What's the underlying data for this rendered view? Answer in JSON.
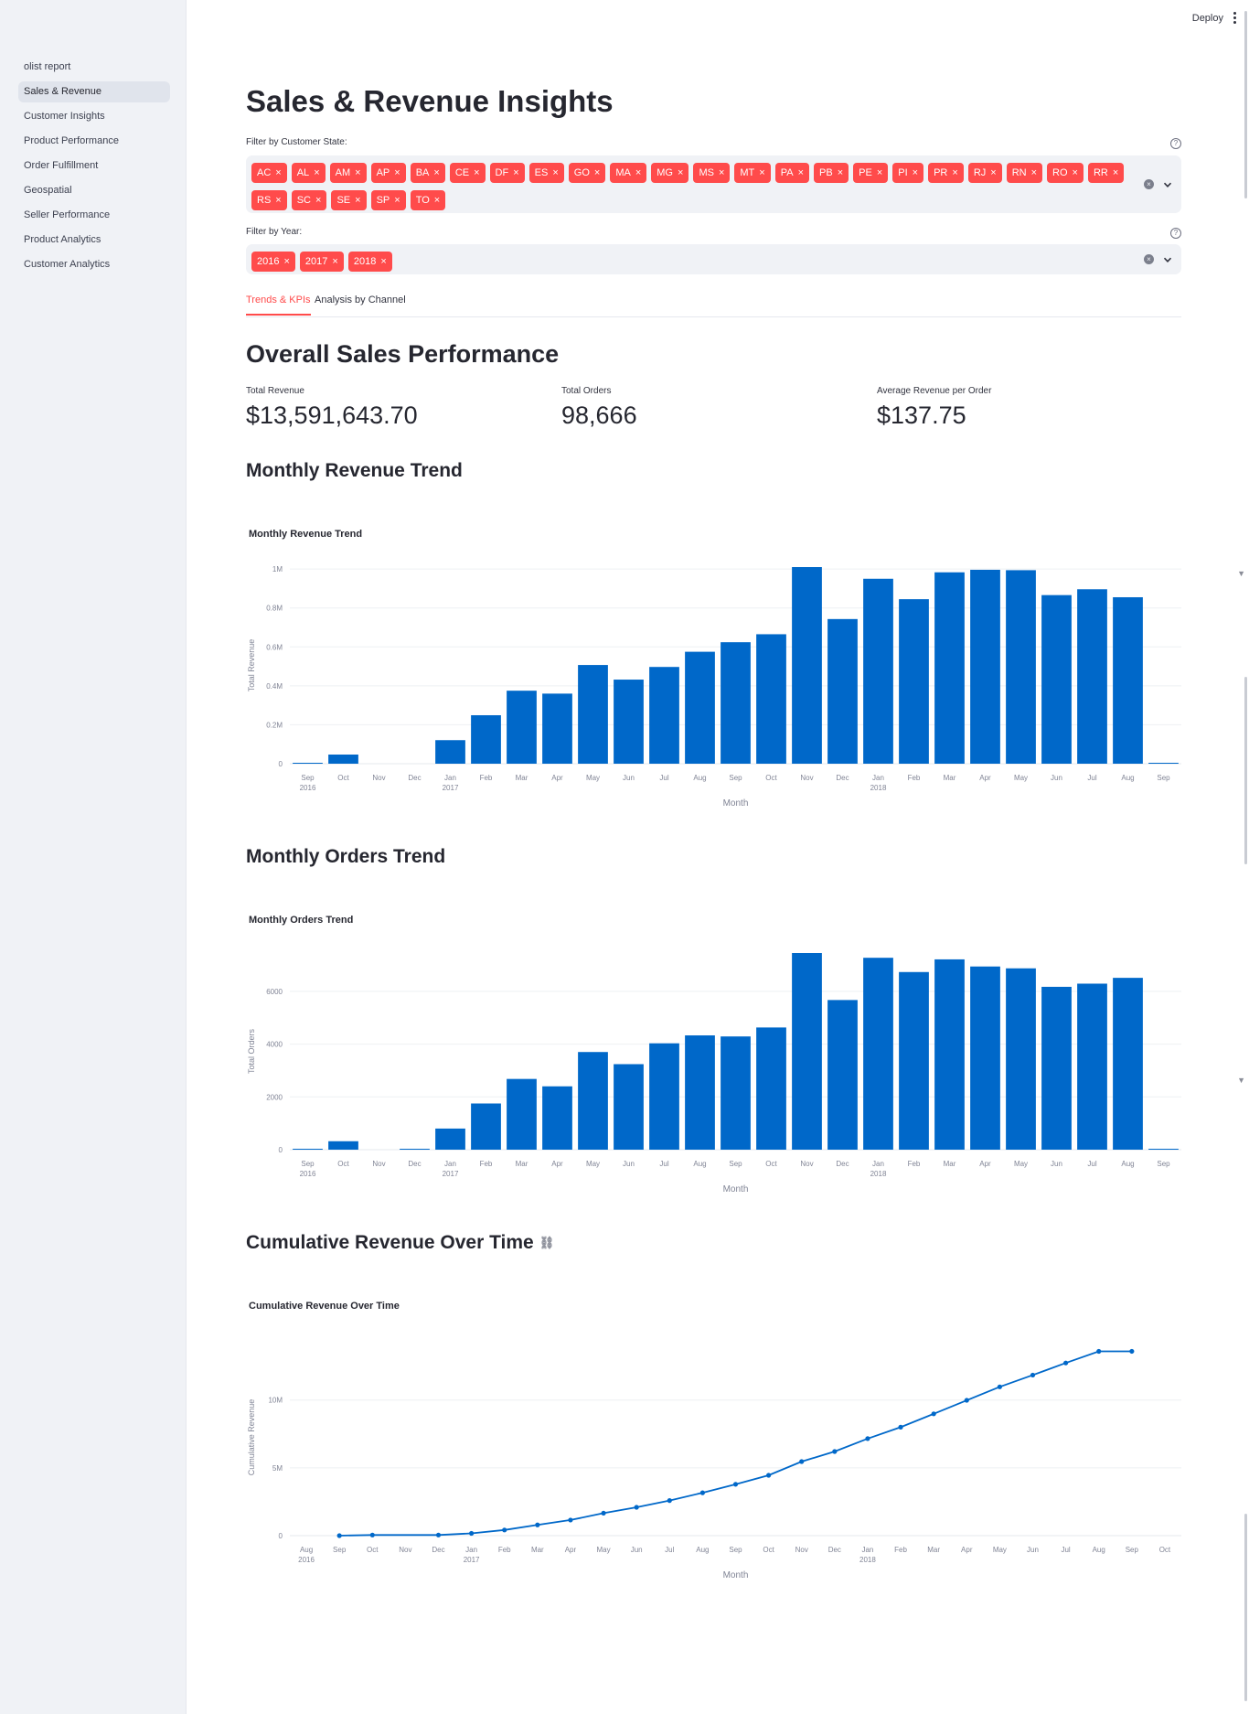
{
  "sidebar": {
    "items": [
      {
        "label": "olist report",
        "active": false
      },
      {
        "label": "Sales & Revenue",
        "active": true
      },
      {
        "label": "Customer Insights",
        "active": false
      },
      {
        "label": "Product Performance",
        "active": false
      },
      {
        "label": "Order Fulfillment",
        "active": false
      },
      {
        "label": "Geospatial",
        "active": false
      },
      {
        "label": "Seller Performance",
        "active": false
      },
      {
        "label": "Product Analytics",
        "active": false
      },
      {
        "label": "Customer Analytics",
        "active": false
      }
    ]
  },
  "header": {
    "deploy_label": "Deploy"
  },
  "page": {
    "title": "Sales & Revenue Insights"
  },
  "filters": {
    "state": {
      "label": "Filter by Customer State:",
      "selected": [
        "AC",
        "AL",
        "AM",
        "AP",
        "BA",
        "CE",
        "DF",
        "ES",
        "GO",
        "MA",
        "MG",
        "MS",
        "MT",
        "PA",
        "PB",
        "PE",
        "PI",
        "PR",
        "RJ",
        "RN",
        "RO",
        "RR",
        "RS",
        "SC",
        "SE",
        "SP",
        "TO"
      ]
    },
    "year": {
      "label": "Filter by Year:",
      "selected": [
        "2016",
        "2017",
        "2018"
      ]
    },
    "chip_remove_glyph": "×",
    "help_glyph": "?",
    "clear_glyph": "×"
  },
  "tabs": [
    {
      "label": "Trends & KPIs",
      "active": true
    },
    {
      "label": "Analysis by Channel",
      "active": false
    }
  ],
  "overview": {
    "heading": "Overall Sales Performance",
    "metrics": [
      {
        "label": "Total Revenue",
        "value": "$13,591,643.70"
      },
      {
        "label": "Total Orders",
        "value": "98,666"
      },
      {
        "label": "Average Revenue per Order",
        "value": "$137.75"
      }
    ]
  },
  "sections": {
    "revenue_heading": "Monthly Revenue Trend",
    "orders_heading": "Monthly Orders Trend",
    "cumulative_heading": "Cumulative Revenue Over Time"
  },
  "colors": {
    "accent": "#ff4b4b",
    "bar": "#0068c9",
    "sidebar_bg": "#f0f2f6"
  },
  "icons": [
    "help-icon",
    "clear-icon",
    "chevron-down-icon",
    "link-icon",
    "kebab-menu-icon"
  ],
  "chart_data": [
    {
      "type": "bar",
      "title": "Monthly Revenue Trend",
      "xlabel": "Month",
      "ylabel": "Total Revenue",
      "x_ticks": [
        [
          "Sep",
          "2016"
        ],
        [
          "Oct",
          ""
        ],
        [
          "Nov",
          ""
        ],
        [
          "Dec",
          ""
        ],
        [
          "Jan",
          "2017"
        ],
        [
          "Feb",
          ""
        ],
        [
          "Mar",
          ""
        ],
        [
          "Apr",
          ""
        ],
        [
          "May",
          ""
        ],
        [
          "Jun",
          ""
        ],
        [
          "Jul",
          ""
        ],
        [
          "Aug",
          ""
        ],
        [
          "Sep",
          ""
        ],
        [
          "Oct",
          ""
        ],
        [
          "Nov",
          ""
        ],
        [
          "Dec",
          ""
        ],
        [
          "Jan",
          "2018"
        ],
        [
          "Feb",
          ""
        ],
        [
          "Mar",
          ""
        ],
        [
          "Apr",
          ""
        ],
        [
          "May",
          ""
        ],
        [
          "Jun",
          ""
        ],
        [
          "Jul",
          ""
        ],
        [
          "Aug",
          ""
        ],
        [
          "Sep",
          ""
        ]
      ],
      "values": [
        300,
        47000,
        0,
        0,
        121000,
        249000,
        375000,
        360000,
        507000,
        432000,
        497000,
        575000,
        624000,
        665000,
        1010000,
        743000,
        950000,
        845000,
        983000,
        996000,
        994000,
        866000,
        896000,
        855000,
        150
      ],
      "y_ticks": [
        {
          "v": 0,
          "label": "0"
        },
        {
          "v": 200000,
          "label": "0.2M"
        },
        {
          "v": 400000,
          "label": "0.4M"
        },
        {
          "v": 600000,
          "label": "0.6M"
        },
        {
          "v": 800000,
          "label": "0.8M"
        },
        {
          "v": 1000000,
          "label": "1M"
        }
      ],
      "ylim": [
        0,
        1010000
      ],
      "grid": true
    },
    {
      "type": "bar",
      "title": "Monthly Orders Trend",
      "xlabel": "Month",
      "ylabel": "Total Orders",
      "x_ticks": [
        [
          "Sep",
          "2016"
        ],
        [
          "Oct",
          ""
        ],
        [
          "Nov",
          ""
        ],
        [
          "Dec",
          ""
        ],
        [
          "Jan",
          "2017"
        ],
        [
          "Feb",
          ""
        ],
        [
          "Mar",
          ""
        ],
        [
          "Apr",
          ""
        ],
        [
          "May",
          ""
        ],
        [
          "Jun",
          ""
        ],
        [
          "Jul",
          ""
        ],
        [
          "Aug",
          ""
        ],
        [
          "Sep",
          ""
        ],
        [
          "Oct",
          ""
        ],
        [
          "Nov",
          ""
        ],
        [
          "Dec",
          ""
        ],
        [
          "Jan",
          "2018"
        ],
        [
          "Feb",
          ""
        ],
        [
          "Mar",
          ""
        ],
        [
          "Apr",
          ""
        ],
        [
          "May",
          ""
        ],
        [
          "Jun",
          ""
        ],
        [
          "Jul",
          ""
        ],
        [
          "Aug",
          ""
        ],
        [
          "Sep",
          ""
        ]
      ],
      "values": [
        4,
        320,
        0,
        1,
        800,
        1750,
        2680,
        2400,
        3700,
        3240,
        4030,
        4330,
        4290,
        4630,
        7450,
        5670,
        7270,
        6730,
        7210,
        6940,
        6870,
        6170,
        6290,
        6510,
        1
      ],
      "y_ticks": [
        {
          "v": 0,
          "label": "0"
        },
        {
          "v": 2000,
          "label": "2000"
        },
        {
          "v": 4000,
          "label": "4000"
        },
        {
          "v": 6000,
          "label": "6000"
        }
      ],
      "ylim": [
        0,
        7450
      ],
      "grid": true
    },
    {
      "type": "line",
      "title": "Cumulative Revenue Over Time",
      "xlabel": "Month",
      "ylabel": "Cumulative Revenue",
      "x_ticks": [
        [
          "Aug",
          "2016"
        ],
        [
          "Sep",
          ""
        ],
        [
          "Oct",
          ""
        ],
        [
          "Nov",
          ""
        ],
        [
          "Dec",
          ""
        ],
        [
          "Jan",
          "2017"
        ],
        [
          "Feb",
          ""
        ],
        [
          "Mar",
          ""
        ],
        [
          "Apr",
          ""
        ],
        [
          "May",
          ""
        ],
        [
          "Jun",
          ""
        ],
        [
          "Jul",
          ""
        ],
        [
          "Aug",
          ""
        ],
        [
          "Sep",
          ""
        ],
        [
          "Oct",
          ""
        ],
        [
          "Nov",
          ""
        ],
        [
          "Dec",
          ""
        ],
        [
          "Jan",
          "2018"
        ],
        [
          "Feb",
          ""
        ],
        [
          "Mar",
          ""
        ],
        [
          "Apr",
          ""
        ],
        [
          "May",
          ""
        ],
        [
          "Jun",
          ""
        ],
        [
          "Jul",
          ""
        ],
        [
          "Aug",
          ""
        ],
        [
          "Sep",
          ""
        ],
        [
          "Oct",
          ""
        ]
      ],
      "x": [
        "2016-09",
        "2016-10",
        "2016-12",
        "2017-01",
        "2017-02",
        "2017-03",
        "2017-04",
        "2017-05",
        "2017-06",
        "2017-07",
        "2017-08",
        "2017-09",
        "2017-10",
        "2017-11",
        "2017-12",
        "2018-01",
        "2018-02",
        "2018-03",
        "2018-04",
        "2018-05",
        "2018-06",
        "2018-07",
        "2018-08",
        "2018-09"
      ],
      "values": [
        300,
        47300,
        47300,
        168000,
        417000,
        792000,
        1152000,
        1659000,
        2091000,
        2588000,
        3163000,
        3787000,
        4452000,
        5462000,
        6205000,
        7155000,
        8000000,
        8983000,
        9979000,
        10973000,
        11839000,
        12735000,
        13590000,
        13591643.7
      ],
      "y_ticks": [
        {
          "v": 0,
          "label": "0"
        },
        {
          "v": 5000000,
          "label": "5M"
        },
        {
          "v": 10000000,
          "label": "10M"
        }
      ],
      "grid": true
    }
  ]
}
